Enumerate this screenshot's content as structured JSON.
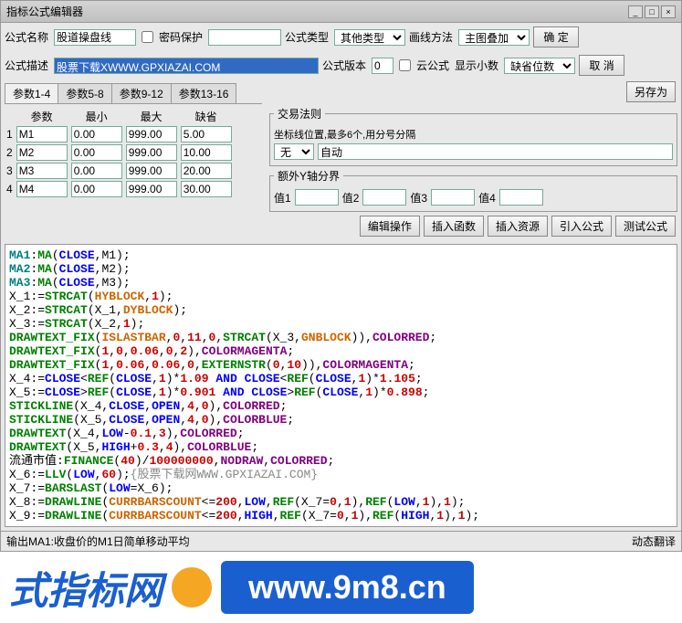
{
  "title": "指标公式编辑器",
  "labels": {
    "name": "公式名称",
    "pwd": "密码保护",
    "type": "公式类型",
    "drawmethod": "画线方法",
    "desc": "公式描述",
    "ver": "公式版本",
    "cloud": "云公式",
    "decimal": "显示小数",
    "ok": "确  定",
    "cancel": "取  消",
    "saveas": "另存为"
  },
  "values": {
    "name": "股道操盘线",
    "desc": "股票下载XWWW.GPXIAZAI.COM",
    "type": "其他类型",
    "drawmethod": "主图叠加",
    "ver": "0",
    "decimal": "缺省位数"
  },
  "tabs": [
    "参数1-4",
    "参数5-8",
    "参数9-12",
    "参数13-16"
  ],
  "paramHdr": [
    "参数",
    "最小",
    "最大",
    "缺省"
  ],
  "params": [
    {
      "i": "1",
      "n": "M1",
      "min": "0.00",
      "max": "999.00",
      "def": "5.00"
    },
    {
      "i": "2",
      "n": "M2",
      "min": "0.00",
      "max": "999.00",
      "def": "10.00"
    },
    {
      "i": "3",
      "n": "M3",
      "min": "0.00",
      "max": "999.00",
      "def": "20.00"
    },
    {
      "i": "4",
      "n": "M4",
      "min": "0.00",
      "max": "999.00",
      "def": "30.00"
    }
  ],
  "trade": {
    "legend": "交易法则",
    "hint": "坐标线位置,最多6个,用分号分隔",
    "none": "无",
    "auto": "自动"
  },
  "extraY": {
    "legend": "额外Y轴分界",
    "v1": "值1",
    "v2": "值2",
    "v3": "值3",
    "v4": "值4"
  },
  "btns": {
    "edit": "编辑操作",
    "func": "插入函数",
    "res": "插入资源",
    "import": "引入公式",
    "test": "测试公式"
  },
  "status": {
    "left": "输出MA1:收盘价的M1日简单移动平均",
    "right": "动态翻译"
  },
  "footer": {
    "cn": "式指标网",
    "url": "www.9m8.cn"
  },
  "code": [
    [
      [
        "teal",
        "MA1"
      ],
      [
        "black",
        ":"
      ],
      [
        "green",
        "MA"
      ],
      [
        "black",
        "("
      ],
      [
        "blue",
        "CLOSE"
      ],
      [
        "black",
        ",M1);"
      ]
    ],
    [
      [
        "teal",
        "MA2"
      ],
      [
        "black",
        ":"
      ],
      [
        "green",
        "MA"
      ],
      [
        "black",
        "("
      ],
      [
        "blue",
        "CLOSE"
      ],
      [
        "black",
        ",M2);"
      ]
    ],
    [
      [
        "teal",
        "MA3"
      ],
      [
        "black",
        ":"
      ],
      [
        "green",
        "MA"
      ],
      [
        "black",
        "("
      ],
      [
        "blue",
        "CLOSE"
      ],
      [
        "black",
        ",M3);"
      ]
    ],
    [
      [
        "black",
        "X_1:="
      ],
      [
        "green",
        "STRCAT"
      ],
      [
        "black",
        "("
      ],
      [
        "orange",
        "HYBLOCK"
      ],
      [
        "black",
        ","
      ],
      [
        "red",
        "1"
      ],
      [
        "black",
        ");"
      ]
    ],
    [
      [
        "black",
        "X_2:="
      ],
      [
        "green",
        "STRCAT"
      ],
      [
        "black",
        "(X_1,"
      ],
      [
        "orange",
        "DYBLOCK"
      ],
      [
        "black",
        ");"
      ]
    ],
    [
      [
        "black",
        "X_3:="
      ],
      [
        "green",
        "STRCAT"
      ],
      [
        "black",
        "(X_2,"
      ],
      [
        "red",
        "1"
      ],
      [
        "black",
        ");"
      ]
    ],
    [
      [
        "green",
        "DRAWTEXT_FIX"
      ],
      [
        "black",
        "("
      ],
      [
        "orange",
        "ISLASTBAR"
      ],
      [
        "black",
        ","
      ],
      [
        "red",
        "0"
      ],
      [
        "black",
        ","
      ],
      [
        "red",
        "11"
      ],
      [
        "black",
        ","
      ],
      [
        "red",
        "0"
      ],
      [
        "black",
        ","
      ],
      [
        "green",
        "STRCAT"
      ],
      [
        "black",
        "(X_3,"
      ],
      [
        "orange",
        "GNBLOCK"
      ],
      [
        "black",
        ")),"
      ],
      [
        "purple",
        "COLORRED"
      ],
      [
        "black",
        ";"
      ]
    ],
    [
      [
        "green",
        "DRAWTEXT_FIX"
      ],
      [
        "black",
        "("
      ],
      [
        "red",
        "1"
      ],
      [
        "black",
        ","
      ],
      [
        "red",
        "0"
      ],
      [
        "black",
        ","
      ],
      [
        "red",
        "0.06"
      ],
      [
        "black",
        ","
      ],
      [
        "red",
        "0"
      ],
      [
        "black",
        ","
      ],
      [
        "red",
        "2"
      ],
      [
        "black",
        "),"
      ],
      [
        "purple",
        "COLORMAGENTA"
      ],
      [
        "black",
        ";"
      ]
    ],
    [
      [
        "green",
        "DRAWTEXT_FIX"
      ],
      [
        "black",
        "("
      ],
      [
        "red",
        "1"
      ],
      [
        "black",
        ","
      ],
      [
        "red",
        "0.06"
      ],
      [
        "black",
        ","
      ],
      [
        "red",
        "0.06"
      ],
      [
        "black",
        ","
      ],
      [
        "red",
        "0"
      ],
      [
        "black",
        ","
      ],
      [
        "green",
        "EXTERNSTR"
      ],
      [
        "black",
        "("
      ],
      [
        "red",
        "0"
      ],
      [
        "black",
        ","
      ],
      [
        "red",
        "10"
      ],
      [
        "black",
        ")),"
      ],
      [
        "purple",
        "COLORMAGENTA"
      ],
      [
        "black",
        ";"
      ]
    ],
    [
      [
        "black",
        "X_4:="
      ],
      [
        "blue",
        "CLOSE"
      ],
      [
        "black",
        "<"
      ],
      [
        "green",
        "REF"
      ],
      [
        "black",
        "("
      ],
      [
        "blue",
        "CLOSE"
      ],
      [
        "black",
        ","
      ],
      [
        "red",
        "1"
      ],
      [
        "black",
        ")*"
      ],
      [
        "red",
        "1.09"
      ],
      [
        "black",
        " "
      ],
      [
        "blue",
        "AND"
      ],
      [
        "black",
        " "
      ],
      [
        "blue",
        "CLOSE"
      ],
      [
        "black",
        "<"
      ],
      [
        "green",
        "REF"
      ],
      [
        "black",
        "("
      ],
      [
        "blue",
        "CLOSE"
      ],
      [
        "black",
        ","
      ],
      [
        "red",
        "1"
      ],
      [
        "black",
        ")*"
      ],
      [
        "red",
        "1.105"
      ],
      [
        "black",
        ";"
      ]
    ],
    [
      [
        "black",
        "X_5:="
      ],
      [
        "blue",
        "CLOSE"
      ],
      [
        "black",
        ">"
      ],
      [
        "green",
        "REF"
      ],
      [
        "black",
        "("
      ],
      [
        "blue",
        "CLOSE"
      ],
      [
        "black",
        ","
      ],
      [
        "red",
        "1"
      ],
      [
        "black",
        ")*"
      ],
      [
        "red",
        "0.901"
      ],
      [
        "black",
        " "
      ],
      [
        "blue",
        "AND"
      ],
      [
        "black",
        " "
      ],
      [
        "blue",
        "CLOSE"
      ],
      [
        "black",
        ">"
      ],
      [
        "green",
        "REF"
      ],
      [
        "black",
        "("
      ],
      [
        "blue",
        "CLOSE"
      ],
      [
        "black",
        ","
      ],
      [
        "red",
        "1"
      ],
      [
        "black",
        ")*"
      ],
      [
        "red",
        "0.898"
      ],
      [
        "black",
        ";"
      ]
    ],
    [
      [
        "green",
        "STICKLINE"
      ],
      [
        "black",
        "(X_4,"
      ],
      [
        "blue",
        "CLOSE"
      ],
      [
        "black",
        ","
      ],
      [
        "blue",
        "OPEN"
      ],
      [
        "black",
        ","
      ],
      [
        "red",
        "4"
      ],
      [
        "black",
        ","
      ],
      [
        "red",
        "0"
      ],
      [
        "black",
        "),"
      ],
      [
        "purple",
        "COLORRED"
      ],
      [
        "black",
        ";"
      ]
    ],
    [
      [
        "green",
        "STICKLINE"
      ],
      [
        "black",
        "(X_5,"
      ],
      [
        "blue",
        "CLOSE"
      ],
      [
        "black",
        ","
      ],
      [
        "blue",
        "OPEN"
      ],
      [
        "black",
        ","
      ],
      [
        "red",
        "4"
      ],
      [
        "black",
        ","
      ],
      [
        "red",
        "0"
      ],
      [
        "black",
        "),"
      ],
      [
        "purple",
        "COLORBLUE"
      ],
      [
        "black",
        ";"
      ]
    ],
    [
      [
        "green",
        "DRAWTEXT"
      ],
      [
        "black",
        "(X_4,"
      ],
      [
        "blue",
        "LOW"
      ],
      [
        "black",
        "-"
      ],
      [
        "red",
        "0.1"
      ],
      [
        "black",
        ","
      ],
      [
        "red",
        "3"
      ],
      [
        "black",
        "),"
      ],
      [
        "purple",
        "COLORRED"
      ],
      [
        "black",
        ";"
      ]
    ],
    [
      [
        "green",
        "DRAWTEXT"
      ],
      [
        "black",
        "(X_5,"
      ],
      [
        "blue",
        "HIGH"
      ],
      [
        "black",
        "+"
      ],
      [
        "red",
        "0.3"
      ],
      [
        "black",
        ","
      ],
      [
        "red",
        "4"
      ],
      [
        "black",
        "),"
      ],
      [
        "purple",
        "COLORBLUE"
      ],
      [
        "black",
        ";"
      ]
    ],
    [
      [
        "black",
        "流通市值:"
      ],
      [
        "green",
        "FINANCE"
      ],
      [
        "black",
        "("
      ],
      [
        "red",
        "40"
      ],
      [
        "black",
        ")/"
      ],
      [
        "red",
        "100000000"
      ],
      [
        "black",
        ","
      ],
      [
        "purple",
        "NODRAW"
      ],
      [
        "black",
        ","
      ],
      [
        "purple",
        "COLORRED"
      ],
      [
        "black",
        ";"
      ]
    ],
    [
      [
        "black",
        "X_6:="
      ],
      [
        "green",
        "LLV"
      ],
      [
        "black",
        "("
      ],
      [
        "blue",
        "LOW"
      ],
      [
        "black",
        ","
      ],
      [
        "red",
        "60"
      ],
      [
        "black",
        ");"
      ],
      [
        "gray",
        "{股票下载网WWW.GPXIAZAI.COM}"
      ]
    ],
    [
      [
        "black",
        "X_7:="
      ],
      [
        "green",
        "BARSLAST"
      ],
      [
        "black",
        "("
      ],
      [
        "blue",
        "LOW"
      ],
      [
        "black",
        "=X_6);"
      ]
    ],
    [
      [
        "black",
        "X_8:="
      ],
      [
        "green",
        "DRAWLINE"
      ],
      [
        "black",
        "("
      ],
      [
        "orange",
        "CURRBARSCOUNT"
      ],
      [
        "black",
        "<="
      ],
      [
        "red",
        "200"
      ],
      [
        "black",
        ","
      ],
      [
        "blue",
        "LOW"
      ],
      [
        "black",
        ","
      ],
      [
        "green",
        "REF"
      ],
      [
        "black",
        "(X_7="
      ],
      [
        "red",
        "0"
      ],
      [
        "black",
        ","
      ],
      [
        "red",
        "1"
      ],
      [
        "black",
        "),"
      ],
      [
        "green",
        "REF"
      ],
      [
        "black",
        "("
      ],
      [
        "blue",
        "LOW"
      ],
      [
        "black",
        ","
      ],
      [
        "red",
        "1"
      ],
      [
        "black",
        "),"
      ],
      [
        "red",
        "1"
      ],
      [
        "black",
        ");"
      ]
    ],
    [
      [
        "black",
        "X_9:="
      ],
      [
        "green",
        "DRAWLINE"
      ],
      [
        "black",
        "("
      ],
      [
        "orange",
        "CURRBARSCOUNT"
      ],
      [
        "black",
        "<="
      ],
      [
        "red",
        "200"
      ],
      [
        "black",
        ","
      ],
      [
        "blue",
        "HIGH"
      ],
      [
        "black",
        ","
      ],
      [
        "green",
        "REF"
      ],
      [
        "black",
        "(X_7="
      ],
      [
        "red",
        "0"
      ],
      [
        "black",
        ","
      ],
      [
        "red",
        "1"
      ],
      [
        "black",
        "),"
      ],
      [
        "green",
        "REF"
      ],
      [
        "black",
        "("
      ],
      [
        "blue",
        "HIGH"
      ],
      [
        "black",
        ","
      ],
      [
        "red",
        "1"
      ],
      [
        "black",
        "),"
      ],
      [
        "red",
        "1"
      ],
      [
        "black",
        ");"
      ]
    ]
  ]
}
